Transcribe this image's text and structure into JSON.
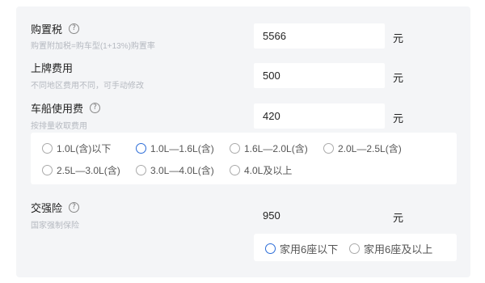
{
  "purchase_tax": {
    "label": "购置税",
    "subtitle": "购置附加税=购车型(1+13%)购置率",
    "value": "5566",
    "unit": "元"
  },
  "license_fee": {
    "label": "上牌费用",
    "subtitle": "不同地区费用不同，可手动修改",
    "value": "500",
    "unit": "元"
  },
  "vehicle_tax": {
    "label": "车船使用费",
    "subtitle": "按排量收取费用",
    "value": "420",
    "unit": "元",
    "options": [
      {
        "label": "1.0L(含)以下",
        "selected": false
      },
      {
        "label": "1.0L—1.6L(含)",
        "selected": true
      },
      {
        "label": "1.6L—2.0L(含)",
        "selected": false
      },
      {
        "label": "2.0L—2.5L(含)",
        "selected": false
      },
      {
        "label": "2.5L—3.0L(含)",
        "selected": false
      },
      {
        "label": "3.0L—4.0L(含)",
        "selected": false
      },
      {
        "label": "4.0L及以上",
        "selected": false
      }
    ]
  },
  "compulsory_insurance": {
    "label": "交强险",
    "subtitle": "国家强制保险",
    "value": "950",
    "unit": "元",
    "options": [
      {
        "label": "家用6座以下",
        "selected": true
      },
      {
        "label": "家用6座及以上",
        "selected": false
      }
    ]
  },
  "help_glyph": "?",
  "colors": {
    "panel_bg": "#f4f5f7",
    "accent": "#2b6cd8",
    "subtitle": "#b5b9c0"
  }
}
